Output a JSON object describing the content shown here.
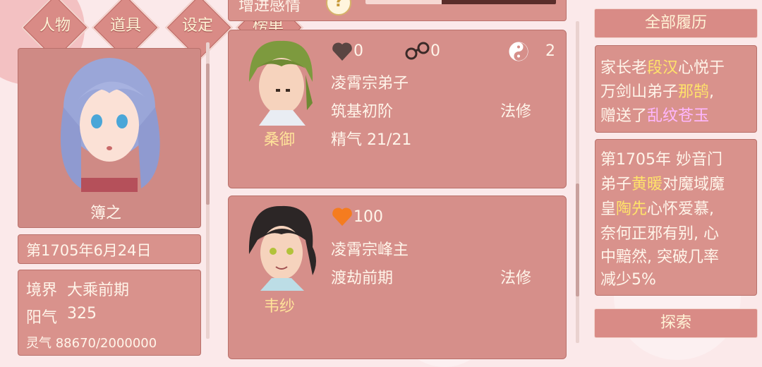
{
  "nav": {
    "character": "人物",
    "items": "道具",
    "settings": "设定",
    "ranking": "榜单"
  },
  "top": {
    "partial_label": "增进感情"
  },
  "player": {
    "name": "簿之",
    "date": "第1705年6月24日",
    "realm_label": "境界",
    "realm_value": "大乘前期",
    "yang_label": "阳气",
    "yang_value": "325",
    "spirit_partial": "灵气 88670/2000000"
  },
  "characters": [
    {
      "name": "桑御",
      "affection": "0",
      "bond": "0",
      "yinyang": "2",
      "sect": "凌霄宗弟子",
      "stage": "筑基初阶",
      "path": "法修",
      "essence": "精气 21/21"
    },
    {
      "name": "韦纱",
      "affection": "100",
      "sect": "凌霄宗峰主",
      "stage": "渡劫前期",
      "path": "法修"
    }
  ],
  "history": {
    "header": "全部履历",
    "entry1": {
      "l1a": "家长老",
      "l1b": "段汉",
      "l1c": "心悦于",
      "l2a": "万剑山弟子",
      "l2b": "那鹄",
      "l2c": ",",
      "l3a": "赠送了",
      "l3b": "乱纹苍玉"
    },
    "entry2": {
      "l1": "第1705年 妙音门",
      "l2a": "弟子",
      "l2b": "黄暖",
      "l2c": "对魔域魔",
      "l3a": "皇",
      "l3b": "陶先",
      "l3c": "心怀爱慕,",
      "l4": "奈何正邪有别, 心",
      "l5": "中黯然, 突破几率",
      "l6": "减少5%"
    },
    "explore": "探索"
  },
  "colors": {
    "panel": "#d9928c",
    "accent_gold": "#ffe39a",
    "highlight_yellow": "#ffe36a",
    "highlight_pink": "#ffb7ff",
    "heart_orange": "#f57c1f"
  }
}
